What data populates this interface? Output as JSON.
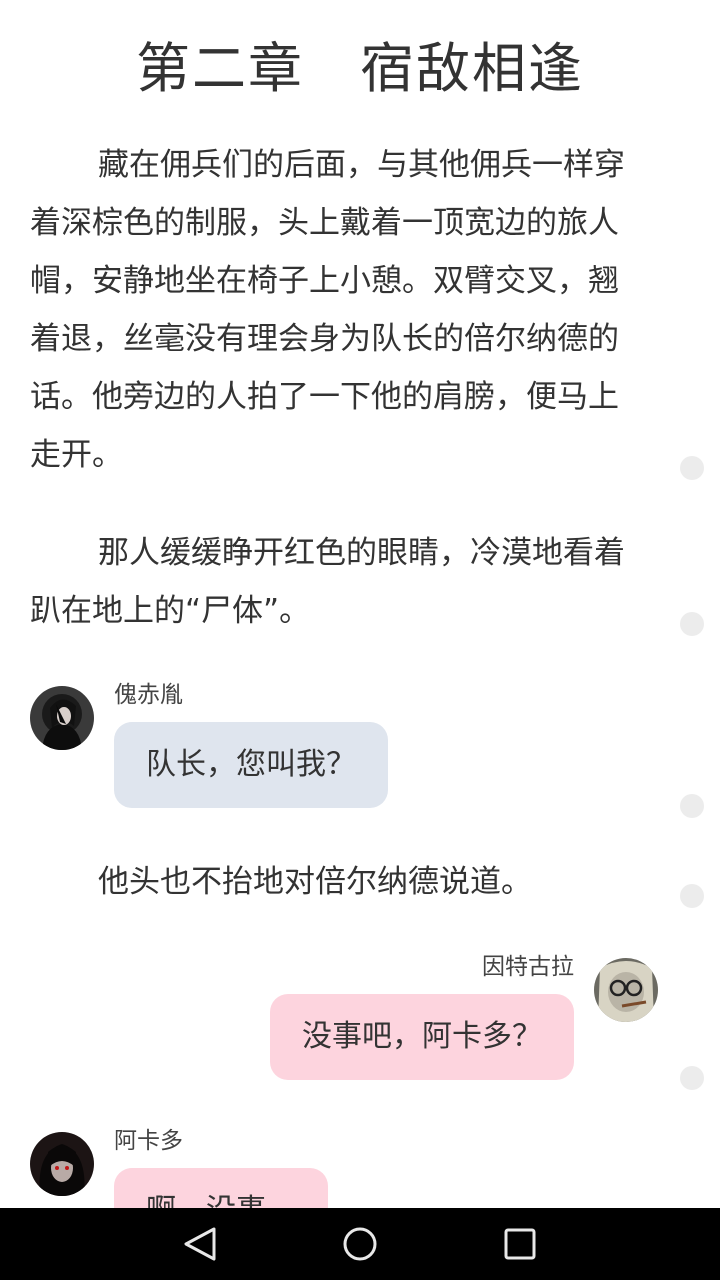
{
  "chapter": {
    "title": "第二章　宿敌相逢"
  },
  "paragraphs": [
    "藏在佣兵们的后面，与其他佣兵一样穿着深棕色的制服，头上戴着一顶宽边的旅人帽，安静地坐在椅子上小憩。双臂交叉，翘着退，丝毫没有理会身为队长的倍尔纳德的话。他旁边的人拍了一下他的肩膀，便马上走开。",
    "那人缓缓睁开红色的眼睛，冷漠地看着趴在地上的“尸体”。",
    "他头也不抬地对倍尔纳德说道。"
  ],
  "dialogue": [
    {
      "speaker": "傀赤胤",
      "text": "队长，您叫我？",
      "side": "left",
      "bubble_color": "#dfe5ee"
    },
    {
      "speaker": "因特古拉",
      "text": "没事吧，阿卡多？",
      "side": "right",
      "bubble_color": "#fdd4de"
    },
    {
      "speaker": "阿卡多",
      "text": "啊，没事。",
      "side": "left",
      "bubble_color": "#fdd4de"
    }
  ],
  "navbar": {
    "back_icon": "triangle-back-icon",
    "home_icon": "circle-home-icon",
    "recents_icon": "square-recents-icon"
  }
}
